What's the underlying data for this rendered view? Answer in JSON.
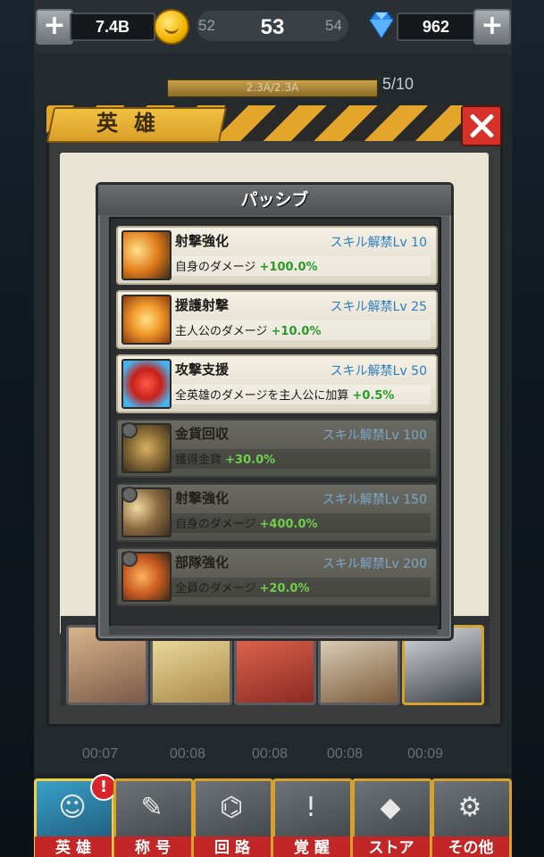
{
  "top_bar": {
    "gold": "7.4B",
    "level_prev": "52",
    "level_current": "53",
    "level_next": "54",
    "gems": "962"
  },
  "stage_progress": {
    "bar_text": "2.3A/2.3A",
    "fill_fraction": 1.0,
    "count": "5/10"
  },
  "hero_panel": {
    "title": "英雄"
  },
  "passive_modal": {
    "title": "パッシブ",
    "skills": [
      {
        "name": "射撃強化",
        "unlock": "スキル解禁Lv 10",
        "desc": "自身のダメージ",
        "value": "+100.0%",
        "unlocked": true
      },
      {
        "name": "援護射撃",
        "unlock": "スキル解禁Lv 25",
        "desc": "主人公のダメージ",
        "value": "+10.0%",
        "unlocked": true
      },
      {
        "name": "攻撃支援",
        "unlock": "スキル解禁Lv 50",
        "desc": "全英雄のダメージを主人公に加算",
        "value": "+0.5%",
        "unlocked": true
      },
      {
        "name": "金貨回収",
        "unlock": "スキル解禁Lv 100",
        "desc": "獲得金貨",
        "value": "+30.0%",
        "unlocked": false
      },
      {
        "name": "射撃強化",
        "unlock": "スキル解禁Lv 150",
        "desc": "自身のダメージ",
        "value": "+400.0%",
        "unlocked": false
      },
      {
        "name": "部隊強化",
        "unlock": "スキル解禁Lv 200",
        "desc": "全員のダメージ",
        "value": "+20.0%",
        "unlocked": false
      }
    ]
  },
  "timers": [
    "00:07",
    "00:08",
    "00:08",
    "00:08",
    "00:09"
  ],
  "bottom_nav": [
    {
      "label": "英 雄",
      "icon": "hero-icon",
      "alert": "!"
    },
    {
      "label": "称 号",
      "icon": "title-icon",
      "alert": ""
    },
    {
      "label": "回 路",
      "icon": "circuit-icon",
      "alert": ""
    },
    {
      "label": "覚 醒",
      "icon": "awaken-icon",
      "alert": ""
    },
    {
      "label": "ストア",
      "icon": "store-gem-icon",
      "alert": ""
    },
    {
      "label": "その他",
      "icon": "wrench-icon",
      "alert": ""
    }
  ],
  "colors": {
    "accent_gold": "#e3a62a",
    "value_green": "#2a9a2a",
    "unlock_blue": "#2b7ec0",
    "close_red": "#d6322a"
  }
}
